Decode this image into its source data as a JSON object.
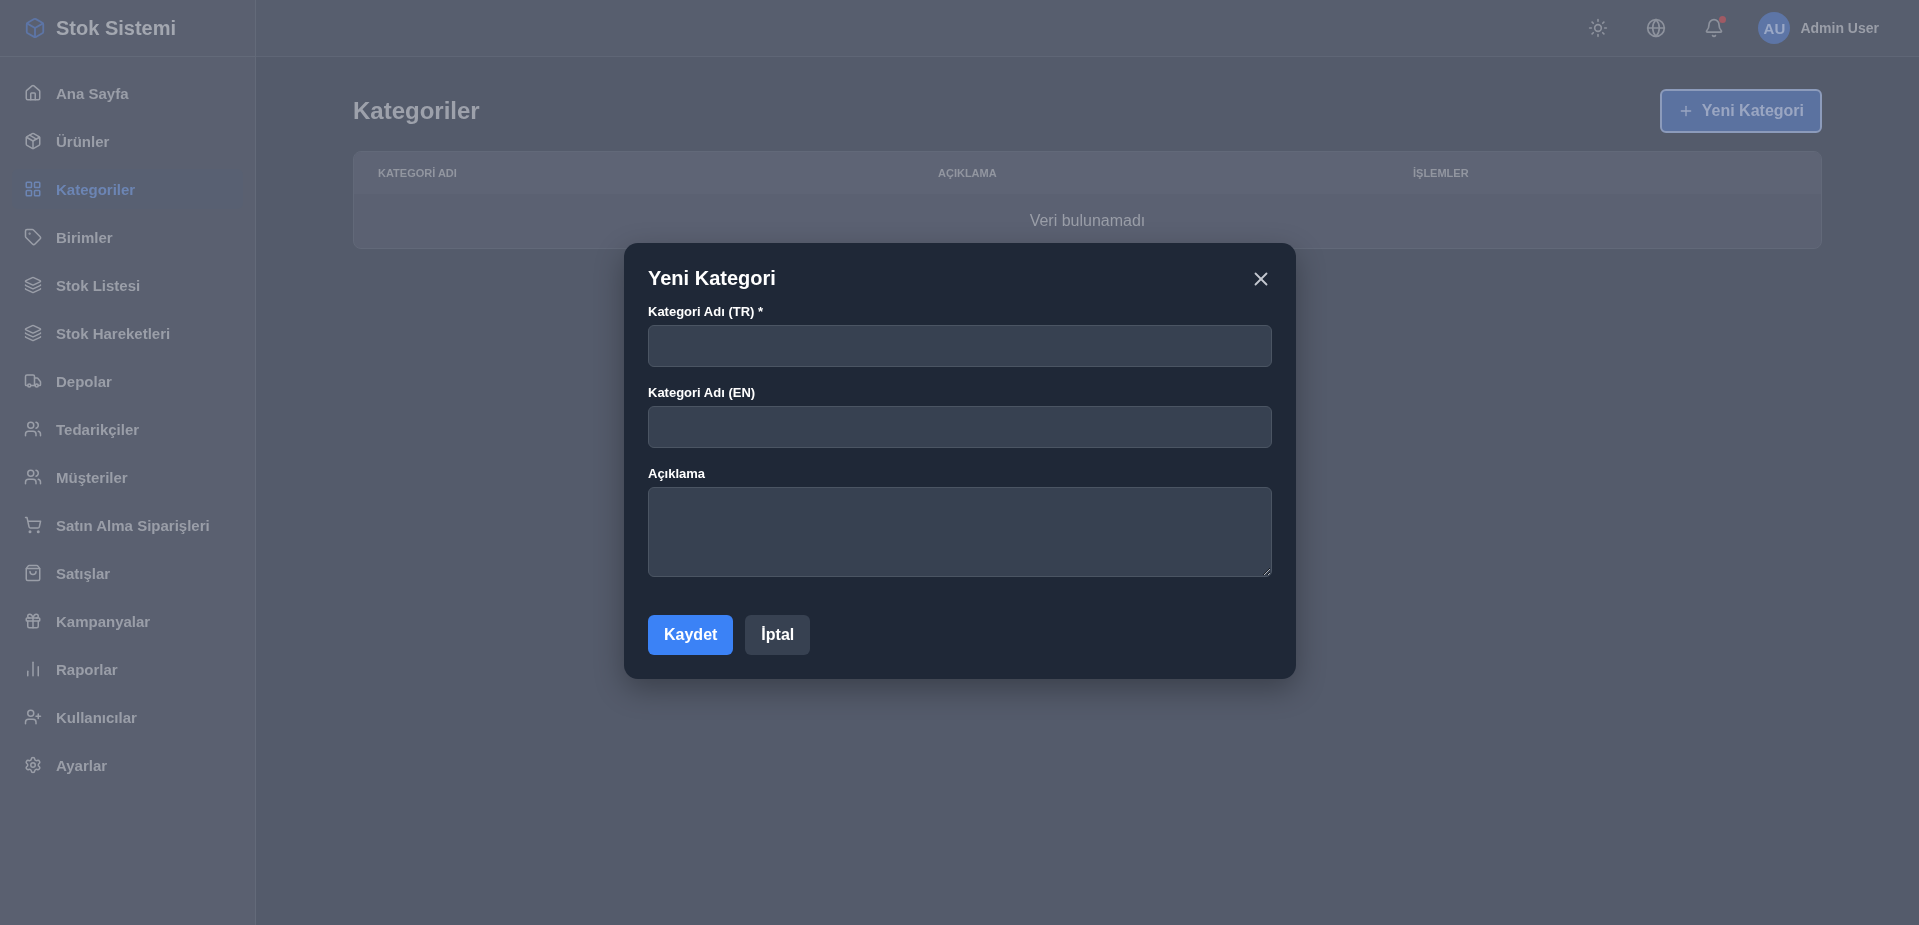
{
  "app": {
    "title": "Stok Sistemi"
  },
  "sidebar": {
    "items": [
      {
        "label": "Ana Sayfa",
        "selected": false
      },
      {
        "label": "Ürünler",
        "selected": false
      },
      {
        "label": "Kategoriler",
        "selected": true
      },
      {
        "label": "Birimler",
        "selected": false
      },
      {
        "label": "Stok Listesi",
        "selected": false
      },
      {
        "label": "Stok Hareketleri",
        "selected": false
      },
      {
        "label": "Depolar",
        "selected": false
      },
      {
        "label": "Tedarikçiler",
        "selected": false
      },
      {
        "label": "Müşteriler",
        "selected": false
      },
      {
        "label": "Satın Alma Siparişleri",
        "selected": false
      },
      {
        "label": "Satışlar",
        "selected": false
      },
      {
        "label": "Kampanyalar",
        "selected": false
      },
      {
        "label": "Raporlar",
        "selected": false
      },
      {
        "label": "Kullanıcılar",
        "selected": false
      },
      {
        "label": "Ayarlar",
        "selected": false
      }
    ]
  },
  "header": {
    "notification_dot": true,
    "user": {
      "initials": "AU",
      "name": "Admin User"
    }
  },
  "page": {
    "title": "Kategoriler",
    "new_button": "Yeni Kategori"
  },
  "table": {
    "columns": [
      "KATEGORİ ADI",
      "AÇIKLAMA",
      "İŞLEMLER"
    ],
    "empty": "Veri bulunamadı"
  },
  "modal": {
    "title": "Yeni Kategori",
    "fields": [
      {
        "kind": "input",
        "label": "Kategori Adı (TR) *"
      },
      {
        "kind": "input",
        "label": "Kategori Adı (EN)"
      },
      {
        "kind": "textarea",
        "label": "Açıklama"
      }
    ],
    "buttons": [
      {
        "kind": "primary",
        "label": "Kaydet"
      },
      {
        "kind": "secondary",
        "label": "İptal"
      }
    ]
  }
}
